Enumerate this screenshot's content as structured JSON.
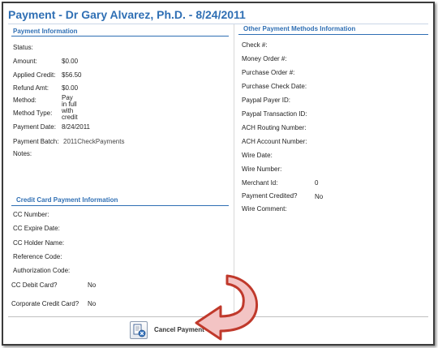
{
  "window": {
    "title": "Payment - Dr Gary Alvarez, Ph.D. - 8/24/2011"
  },
  "payment_info": {
    "heading": "Payment Information",
    "status_label": "Status:",
    "status_value": "",
    "amount_label": "Amount:",
    "amount_value": "$0.00",
    "applied_credit_label": "Applied Credit:",
    "applied_credit_value": "$56.50",
    "refund_label": "Refund Amt:",
    "refund_value": "$0.00",
    "method_label": "Method:",
    "method_value": "Pay in full with credit",
    "method_type_label": "Method Type:",
    "payment_date_label": "Payment Date:",
    "payment_date_value": "8/24/2011",
    "payment_batch_label": "Payment Batch:",
    "payment_batch_value": "2011CheckPayments",
    "notes_label": "Notes:"
  },
  "credit_card": {
    "heading": "Credit Card Payment Information",
    "cc_number_label": "CC Number:",
    "cc_expire_label": "CC Expire Date:",
    "cc_holder_label": "CC Holder Name:",
    "reference_label": "Reference Code:",
    "authorization_label": "Authorization Code:",
    "debit_label": "CC Debit Card?",
    "debit_value": "No",
    "corporate_label": "Corporate Credit Card?",
    "corporate_value": "No"
  },
  "other_methods": {
    "heading": "Other Payment Methods Information",
    "check_label": "Check #:",
    "money_order_label": "Money Order #:",
    "purchase_order_label": "Purchase Order #:",
    "purchase_check_date_label": "Purchase Check Date:",
    "paypal_payer_label": "Paypal Payer ID:",
    "paypal_txn_label": "Paypal Transaction ID:",
    "ach_routing_label": "ACH Routing Number:",
    "ach_account_label": "ACH Account Number:",
    "wire_date_label": "Wire Date:",
    "wire_number_label": "Wire Number:",
    "merchant_label": "Merchant Id:",
    "merchant_value": "0",
    "credited_label": "Payment Credited?",
    "credited_value": "No",
    "wire_comment_label": "Wire Comment:"
  },
  "footer": {
    "cancel_label": "Cancel Payment"
  },
  "colors": {
    "accent": "#2f6fb4",
    "arrow_fill": "#f3c4c4",
    "arrow_stroke": "#c0392b"
  },
  "icons": {
    "cancel": "cancel-payment-icon",
    "pointer": "curved-arrow-icon"
  }
}
